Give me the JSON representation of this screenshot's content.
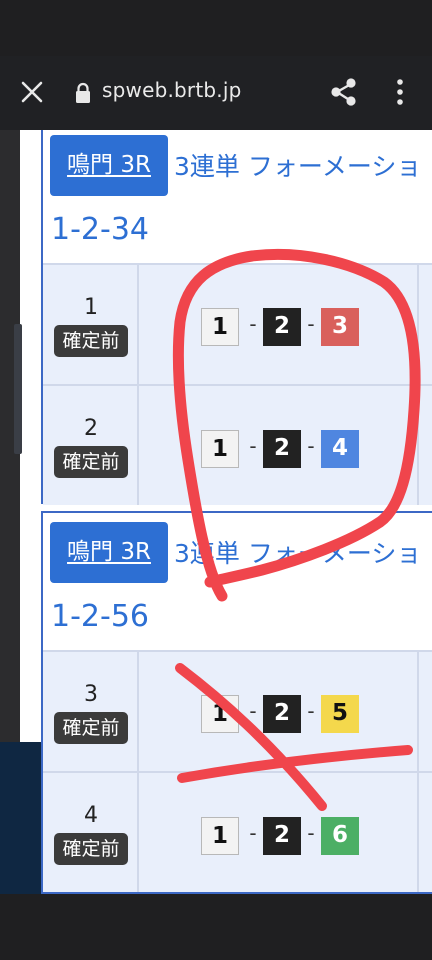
{
  "browser": {
    "url": "spweb.brtb.jp",
    "icons": {
      "close": "close-icon",
      "lock": "lock-icon",
      "share": "share-icon",
      "menu": "more-vert-icon"
    }
  },
  "cards": [
    {
      "race_tag": "鳴門 3R",
      "race_type": "3連単 フォーメーショ",
      "combo": "1-2-34",
      "rows": [
        {
          "num": "1",
          "status": "確定前",
          "boats": [
            "1",
            "2",
            "3"
          ]
        },
        {
          "num": "2",
          "status": "確定前",
          "boats": [
            "1",
            "2",
            "4"
          ]
        }
      ]
    },
    {
      "race_tag": "鳴門 3R",
      "race_type": "3連単 フォーメーショ",
      "combo": "1-2-56",
      "rows": [
        {
          "num": "3",
          "status": "確定前",
          "boats": [
            "1",
            "2",
            "5"
          ]
        },
        {
          "num": "4",
          "status": "確定前",
          "boats": [
            "1",
            "2",
            "6"
          ]
        }
      ]
    }
  ],
  "dash": "-",
  "colors": {
    "accent": "#2d6fd3",
    "boat1": "#f3f3f3",
    "boat2": "#222222",
    "boat3": "#d9605c",
    "boat4": "#4f86e0",
    "boat5": "#f4d84c",
    "boat6": "#4caf65",
    "ink": "#f0454c"
  }
}
